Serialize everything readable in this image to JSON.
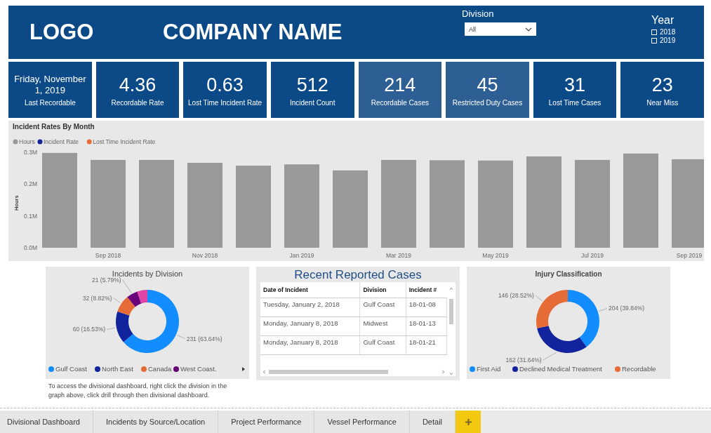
{
  "header": {
    "logo": "LOGO",
    "company_name": "COMPANY NAME",
    "division_filter": {
      "label": "Division",
      "value": "All"
    },
    "year_filter": {
      "label": "Year",
      "options": [
        {
          "label": "2018",
          "checked": false
        },
        {
          "label": "2019",
          "checked": false
        }
      ]
    }
  },
  "kpis": [
    {
      "kind": "date",
      "value": "Friday, November 1, 2019",
      "label": "Last Recordable",
      "highlighted": false
    },
    {
      "kind": "metric",
      "value": "4.36",
      "label": "Recordable Rate",
      "highlighted": false
    },
    {
      "kind": "metric",
      "value": "0.63",
      "label": "Lost Time Incident Rate",
      "highlighted": false
    },
    {
      "kind": "metric",
      "value": "512",
      "label": "Incident Count",
      "highlighted": false
    },
    {
      "kind": "metric",
      "value": "214",
      "label": "Recordable Cases",
      "highlighted": true
    },
    {
      "kind": "metric",
      "value": "45",
      "label": "Restricted Duty Cases",
      "highlighted": true
    },
    {
      "kind": "metric",
      "value": "31",
      "label": "Lost Time Cases",
      "highlighted": false
    },
    {
      "kind": "metric",
      "value": "23",
      "label": "Near Miss",
      "highlighted": false
    }
  ],
  "monthly_chart": {
    "legend": [
      {
        "name": "Hours",
        "color": "#999999"
      },
      {
        "name": "Incident Rate",
        "color": "#12239e"
      },
      {
        "name": "Lost Time Incident Rate",
        "color": "#e66c37"
      }
    ],
    "chart_data": {
      "type": "bar",
      "title": "Incident Rates By Month",
      "ylabel": "Hours",
      "categories": [
        null,
        "Sep 2018",
        null,
        "Nov 2018",
        null,
        "Jan 2019",
        null,
        "Mar 2019",
        null,
        "May 2019",
        null,
        "Jul 2019",
        null,
        "Sep 2019"
      ],
      "series": [
        {
          "color": "#999999",
          "values": [
            0.298,
            0.276,
            0.276,
            0.267,
            0.258,
            0.262,
            0.243,
            0.276,
            0.275,
            0.274,
            0.287,
            0.276,
            0.296,
            0.278
          ]
        }
      ],
      "ylim": [
        0,
        0.3
      ],
      "yticks": [
        {
          "value": 0,
          "label": "0.0M"
        },
        {
          "value": 0.1,
          "label": "0.1M"
        },
        {
          "value": 0.2,
          "label": "0.2M"
        },
        {
          "value": 0.3,
          "label": "0.3M"
        }
      ]
    }
  },
  "division_chart": {
    "legend": [
      {
        "name": "Gulf Coast",
        "color": "#118dff"
      },
      {
        "name": "North East",
        "color": "#12239e"
      },
      {
        "name": "Canada",
        "color": "#e66c37"
      },
      {
        "name": "West Coast.",
        "color": "#6b007b"
      }
    ],
    "chart_data": {
      "type": "donut",
      "title": "Incidents by Division",
      "series": [
        {
          "values": [
            63.64,
            16.53,
            8.82,
            5.79,
            5.22
          ],
          "colors": [
            "#118dff",
            "#12239e",
            "#e66c37",
            "#6b007b",
            "#e044a7"
          ]
        }
      ],
      "value_labels": [
        "231 (63.64%)",
        "60 (16.53%)",
        "32 (8.82%)",
        "21 (5.79%)",
        null
      ]
    },
    "note": "To access the divisional dashboard, right click the division in the graph above, click drill through then divisional dashboard."
  },
  "recent_cases": {
    "title": "Recent Reported Cases",
    "columns": [
      "Date of Incident",
      "Division",
      "Incident #"
    ],
    "rows": [
      [
        "Tuesday, January 2, 2018",
        "Gulf Coast",
        "18-01-08"
      ],
      [
        "Monday, January 8, 2018",
        "Midwest",
        "18-01-13"
      ],
      [
        "Monday, January 8, 2018",
        "Gulf Coast",
        "18-01-21"
      ]
    ]
  },
  "injury_chart": {
    "legend": [
      {
        "name": "First Aid",
        "color": "#118dff"
      },
      {
        "name": "Declined Medical Treatment",
        "color": "#12239e"
      },
      {
        "name": "Recordable",
        "color": "#e66c37"
      }
    ],
    "chart_data": {
      "type": "donut",
      "title": "Injury Classification",
      "series": [
        {
          "values": [
            39.84,
            31.64,
            28.52
          ],
          "colors": [
            "#118dff",
            "#12239e",
            "#e66c37"
          ]
        }
      ],
      "value_labels": [
        "204 (39.84%)",
        "162 (31.64%)",
        "146 (28.52%)"
      ]
    }
  },
  "page_tabs": [
    {
      "label": "Divisional Dashboard"
    },
    {
      "label": "Incidents by Source/Location"
    },
    {
      "label": "Project Performance"
    },
    {
      "label": "Vessel Performance"
    },
    {
      "label": "Detail"
    }
  ]
}
